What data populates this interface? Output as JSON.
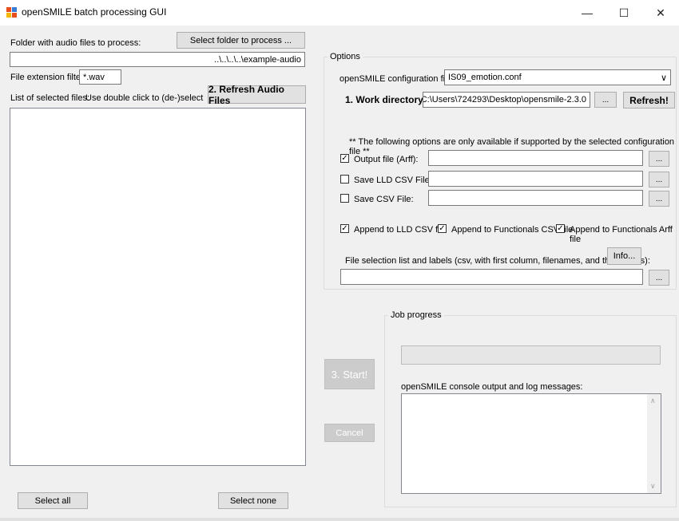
{
  "window": {
    "title": "openSMILE batch processing GUI",
    "minimize": "—",
    "maximize": "☐",
    "close": "✕"
  },
  "left": {
    "folder_label": "Folder with audio files to process:",
    "select_folder_button": "Select folder to process ...",
    "folder_path": "..\\..\\..\\..\\example-audio",
    "ext_label": "File extension filter:",
    "ext_value": "*.wav",
    "list_label": "List of selected files:",
    "list_hint": "Use double click to (de-)select",
    "refresh_button": "2. Refresh Audio Files",
    "select_all": "Select all",
    "select_none": "Select none"
  },
  "options": {
    "legend": "Options",
    "config_label": "openSMILE configuration file:",
    "config_value": "IS09_emotion.conf",
    "workdir_label": "1. Work directory:",
    "workdir_value": "C:\\Users\\724293\\Desktop\\opensmile-2.3.0",
    "browse": "...",
    "refresh_button": "Refresh!",
    "note": "** The following options are only available if supported by the selected configuration file **",
    "output_arff": {
      "label": "Output file (Arff):",
      "checked": true,
      "value": ""
    },
    "save_lld_csv": {
      "label": "Save LLD CSV File:",
      "checked": false,
      "value": ""
    },
    "save_csv": {
      "label": "Save CSV File:",
      "checked": false,
      "value": ""
    },
    "append_lld": {
      "label": "Append to LLD CSV file",
      "checked": true
    },
    "append_func_csv": {
      "label": "Append to Functionals CSV file",
      "checked": true
    },
    "append_func_arff": {
      "label": "Append to Functionals Arff file",
      "checked": true
    },
    "filelist_label": "File selection list and labels (csv, with first column, filenames, and then labels):",
    "info_button": "Info...",
    "filelist_value": ""
  },
  "job": {
    "start_button": "3. Start!",
    "cancel_button": "Cancel",
    "legend": "Job progress",
    "progress": 0,
    "console_label": "openSMILE console output and log messages:",
    "scroll_up": "∧",
    "scroll_down": "∨"
  },
  "checkmark": "✓",
  "dropdown_arrow": "∨"
}
